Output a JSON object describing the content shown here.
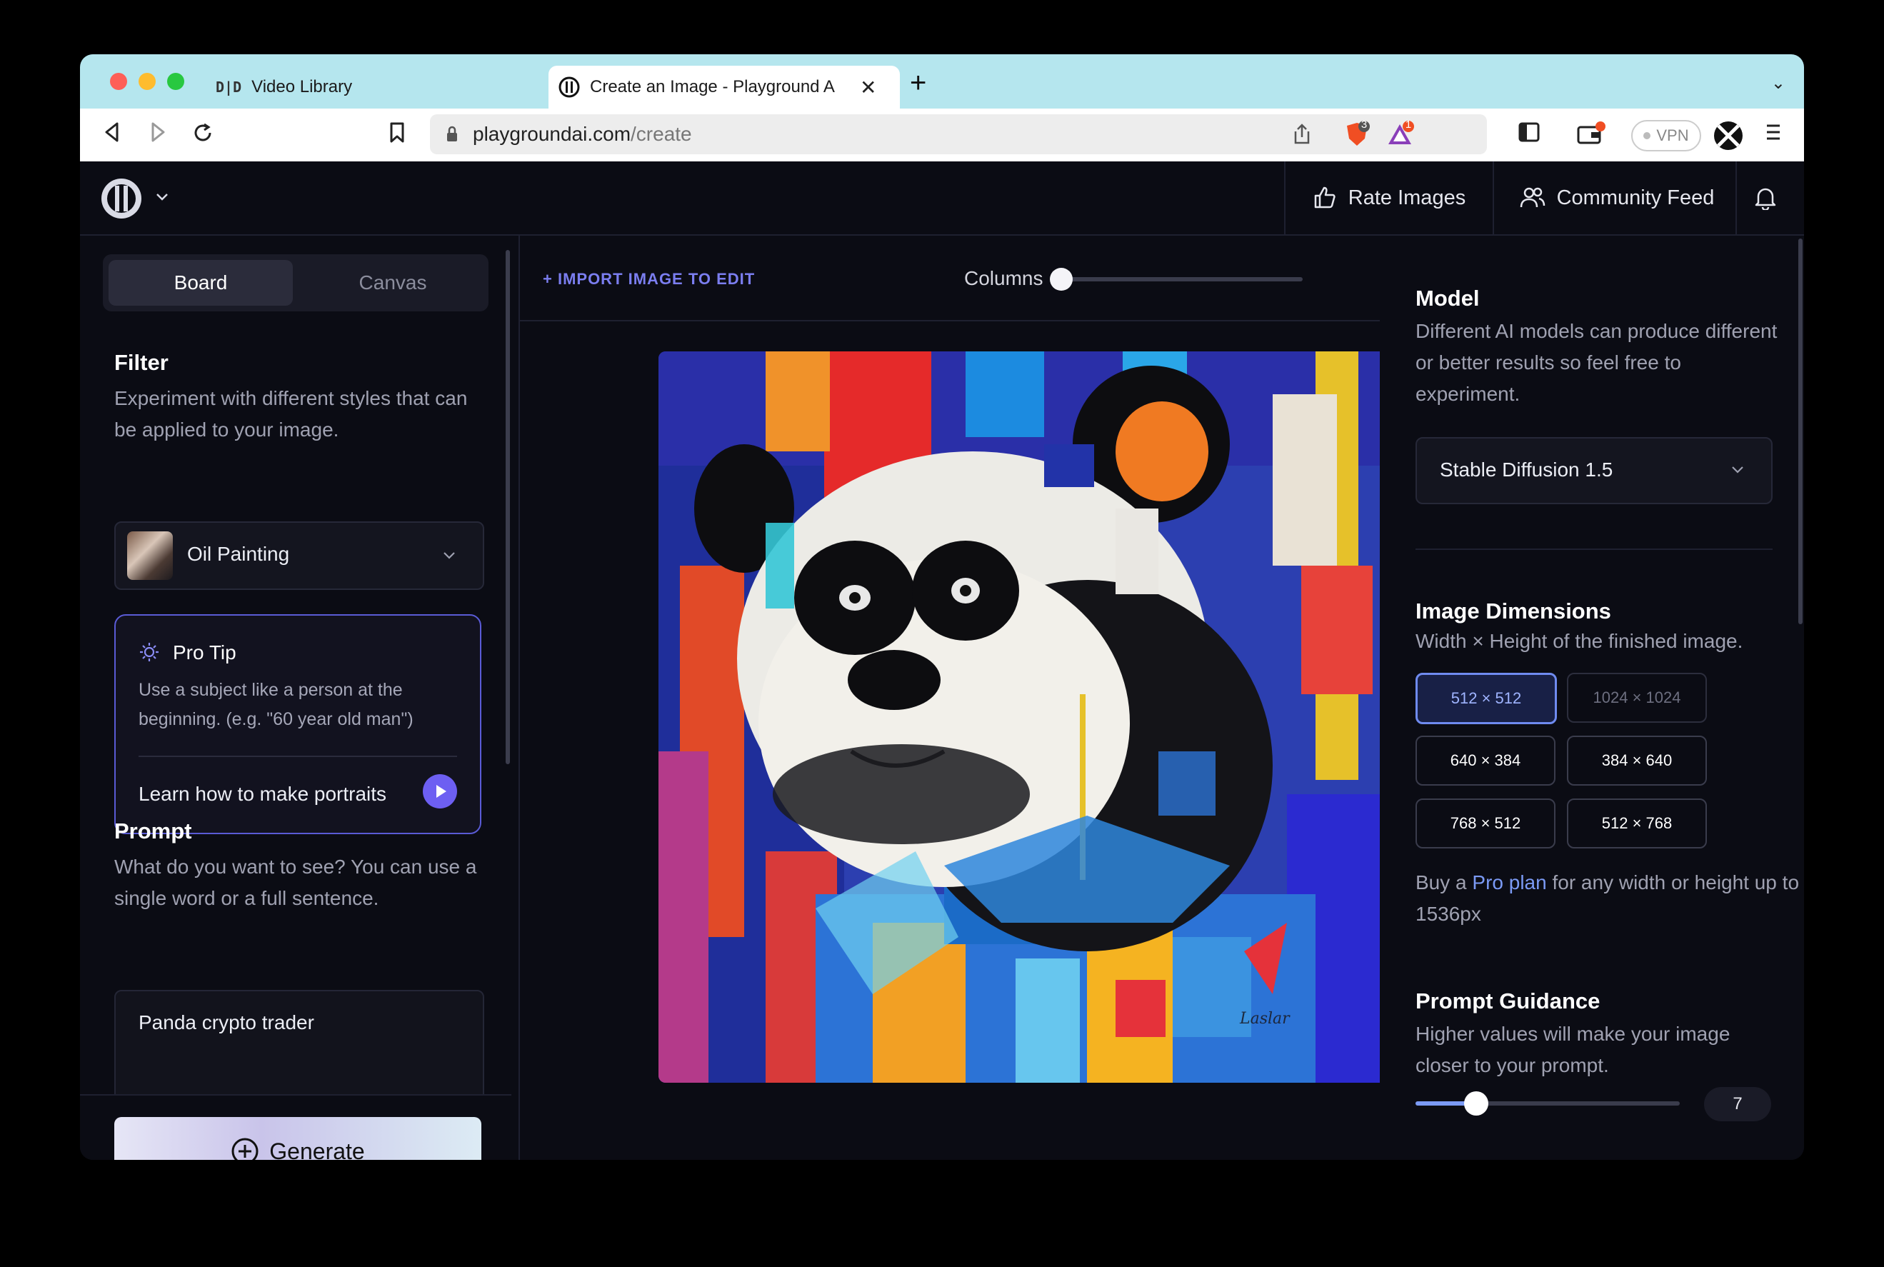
{
  "browser": {
    "tabs": [
      {
        "label": "Video Library",
        "icon": "did-logo-icon"
      },
      {
        "label": "Create an Image - Playground A",
        "icon": "playground-logo-icon"
      }
    ],
    "url_host": "playgroundai.com",
    "url_path": "/create",
    "vpn_label": "VPN",
    "shield_badge": "3",
    "alert_badge": "1"
  },
  "header": {
    "rate_images": "Rate Images",
    "community_feed": "Community Feed"
  },
  "left": {
    "mode_tabs": {
      "board": "Board",
      "canvas": "Canvas",
      "active": "Board"
    },
    "filter": {
      "title": "Filter",
      "description": "Experiment with different styles that can be applied to your image.",
      "selected": "Oil Painting"
    },
    "pro_tip": {
      "title": "Pro Tip",
      "text": "Use a subject like a person at the beginning. (e.g. \"60 year old man\")",
      "link": "Learn how to make portraits"
    },
    "prompt": {
      "title": "Prompt",
      "description": "What do you want to see? You can use a single word or a full sentence.",
      "value": "Panda crypto trader"
    },
    "generate_label": "Generate"
  },
  "center": {
    "import_label": "+ IMPORT IMAGE TO EDIT",
    "columns_label": "Columns",
    "image_signature": "Laslar"
  },
  "right": {
    "model": {
      "title": "Model",
      "description": "Different AI models can produce different or better results so feel free to experiment.",
      "selected": "Stable Diffusion 1.5"
    },
    "dimensions": {
      "title": "Image Dimensions",
      "description": "Width × Height of the finished image.",
      "options": [
        "512 × 512",
        "1024 × 1024",
        "640 × 384",
        "384 × 640",
        "768 × 512",
        "512 × 768"
      ],
      "selected": "512 × 512",
      "note_prefix": "Buy a",
      "note_link": "Pro plan",
      "note_suffix": "for any width or height up to 1536px"
    },
    "guidance": {
      "title": "Prompt Guidance",
      "description": "Higher values will make your image closer to your prompt.",
      "value": "7"
    }
  },
  "colors": {
    "accent": "#6f8bf0",
    "pro_tip_border": "#5a5bd6",
    "tab_bar": "#b5e6ee",
    "background": "#0b0c14"
  }
}
